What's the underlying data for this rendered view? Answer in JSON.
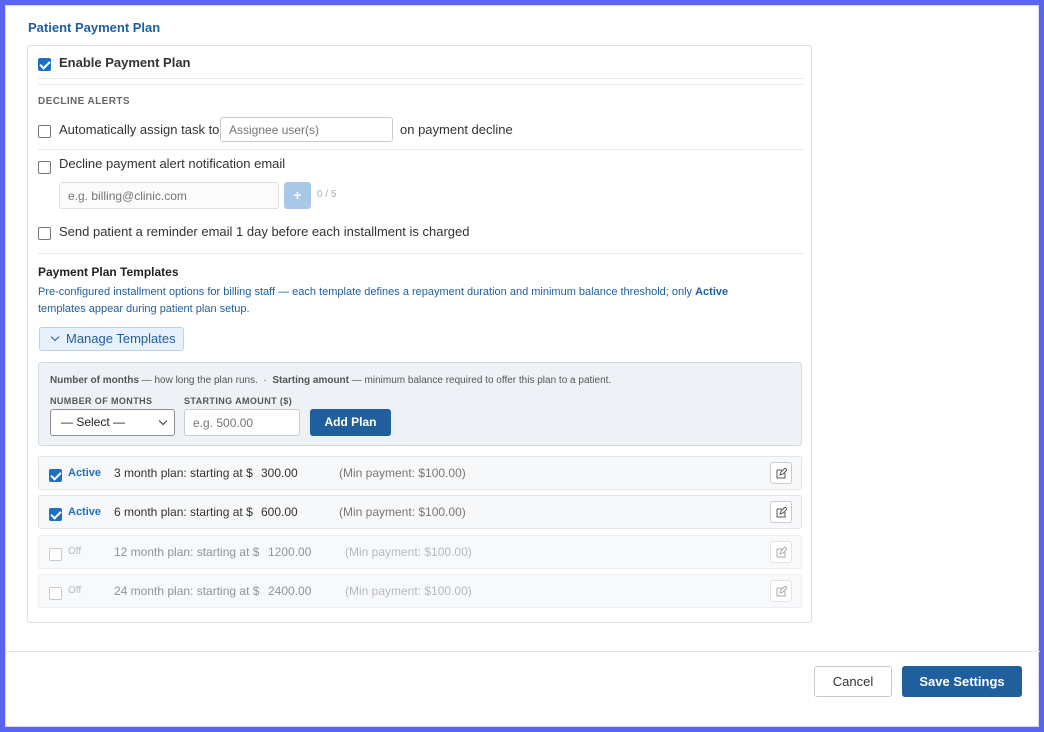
{
  "section_title": "Patient Payment Plan",
  "enable": {
    "label": "Enable Payment Plan",
    "checked": true
  },
  "decline_alerts": {
    "heading": "DECLINE ALERTS",
    "assign_task": {
      "label_before": "Automatically assign task to",
      "placeholder": "Assignee user(s)",
      "label_after": "on payment decline"
    },
    "alert_email": {
      "label": "Decline payment alert notification email",
      "placeholder": "e.g. billing@clinic.com",
      "add_symbol": "+",
      "count": "0 / 5"
    },
    "reminder": {
      "label": "Send patient a reminder email 1 day before each installment is charged"
    }
  },
  "templates": {
    "heading": "Payment Plan Templates",
    "desc_part1": "Pre-configured installment options for billing staff — each template defines a repayment duration and minimum balance threshold; only ",
    "desc_bold": "Active",
    "desc_part2": "templates appear during patient plan setup.",
    "manage_label": "Manage Templates",
    "help_months_bold": "Number of months",
    "help_months_text": "— how long the plan runs.",
    "help_sep": "·",
    "help_amount_bold": "Starting amount",
    "help_amount_text": "— minimum balance required to offer this plan to a patient.",
    "months_label": "NUMBER OF MONTHS",
    "months_selected": "— Select —",
    "amount_label": "STARTING AMOUNT ($)",
    "amount_placeholder": "e.g. 500.00",
    "add_plan_label": "Add Plan",
    "plans": [
      {
        "status": "Active",
        "desc": "3 month plan: starting at $",
        "amount": "300.00",
        "min": "(Min payment: $100.00)",
        "active": true
      },
      {
        "status": "Active",
        "desc": "6 month plan: starting at $",
        "amount": "600.00",
        "min": "(Min payment: $100.00)",
        "active": true
      },
      {
        "status": "Off",
        "desc": "12 month plan: starting at $",
        "amount": "1200.00",
        "min": "(Min payment: $100.00)",
        "active": false
      },
      {
        "status": "Off",
        "desc": "24 month plan: starting at $",
        "amount": "2400.00",
        "min": "(Min payment: $100.00)",
        "active": false
      }
    ]
  },
  "footer": {
    "cancel_label": "Cancel",
    "save_label": "Save Settings"
  },
  "colors": {
    "accent": "#1f5f9e",
    "checkbox": "#1f6fc5",
    "frame": "#5b63f0"
  },
  "icons": [
    "check-icon",
    "chevron-down-icon",
    "edit-icon",
    "plus-icon"
  ]
}
